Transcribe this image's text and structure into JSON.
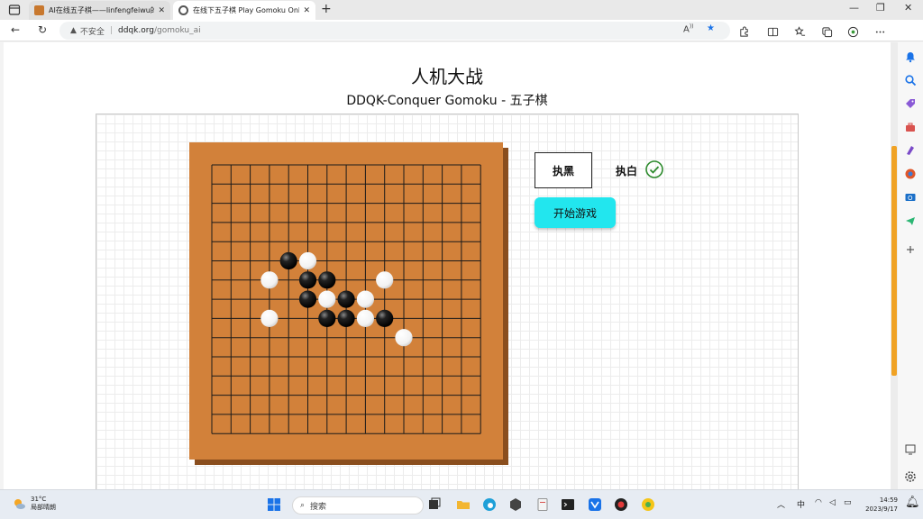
{
  "browser": {
    "tabs": [
      {
        "title": "AI在线五子棋——linfengfeiwu的",
        "favicon_color": "#c8782e",
        "active": false
      },
      {
        "title": "在线下五子棋 Play Gomoku Onli",
        "favicon_color": "#555555",
        "active": true
      }
    ],
    "new_tab_label": "+",
    "address": {
      "security_label": "不安全",
      "host": "ddqk.org",
      "path": "/gomoku_ai"
    }
  },
  "page": {
    "title": "人机大战",
    "subtitle": "DDQK-Conquer Gomoku - 五子棋",
    "controls": {
      "play_black_label": "执黑",
      "play_white_label": "执白",
      "start_label": "开始游戏"
    },
    "board": {
      "size": 15,
      "black_stones": [
        [
          5,
          4
        ],
        [
          6,
          5
        ],
        [
          6,
          6
        ],
        [
          7,
          5
        ],
        [
          7,
          7
        ],
        [
          8,
          6
        ],
        [
          8,
          7
        ],
        [
          8,
          9
        ]
      ],
      "white_stones": [
        [
          5,
          5
        ],
        [
          6,
          3
        ],
        [
          6,
          9
        ],
        [
          7,
          6
        ],
        [
          7,
          8
        ],
        [
          8,
          3
        ],
        [
          8,
          8
        ],
        [
          9,
          10
        ]
      ]
    }
  },
  "taskbar": {
    "weather_temp": "31°C",
    "weather_desc": "局部晴朗",
    "search_placeholder": "搜索",
    "ime_label": "中",
    "time": "14:59",
    "date": "2023/9/17"
  },
  "colors": {
    "board": "#d2813a",
    "start_button": "#22e6ee",
    "accent": "#f0a224"
  }
}
